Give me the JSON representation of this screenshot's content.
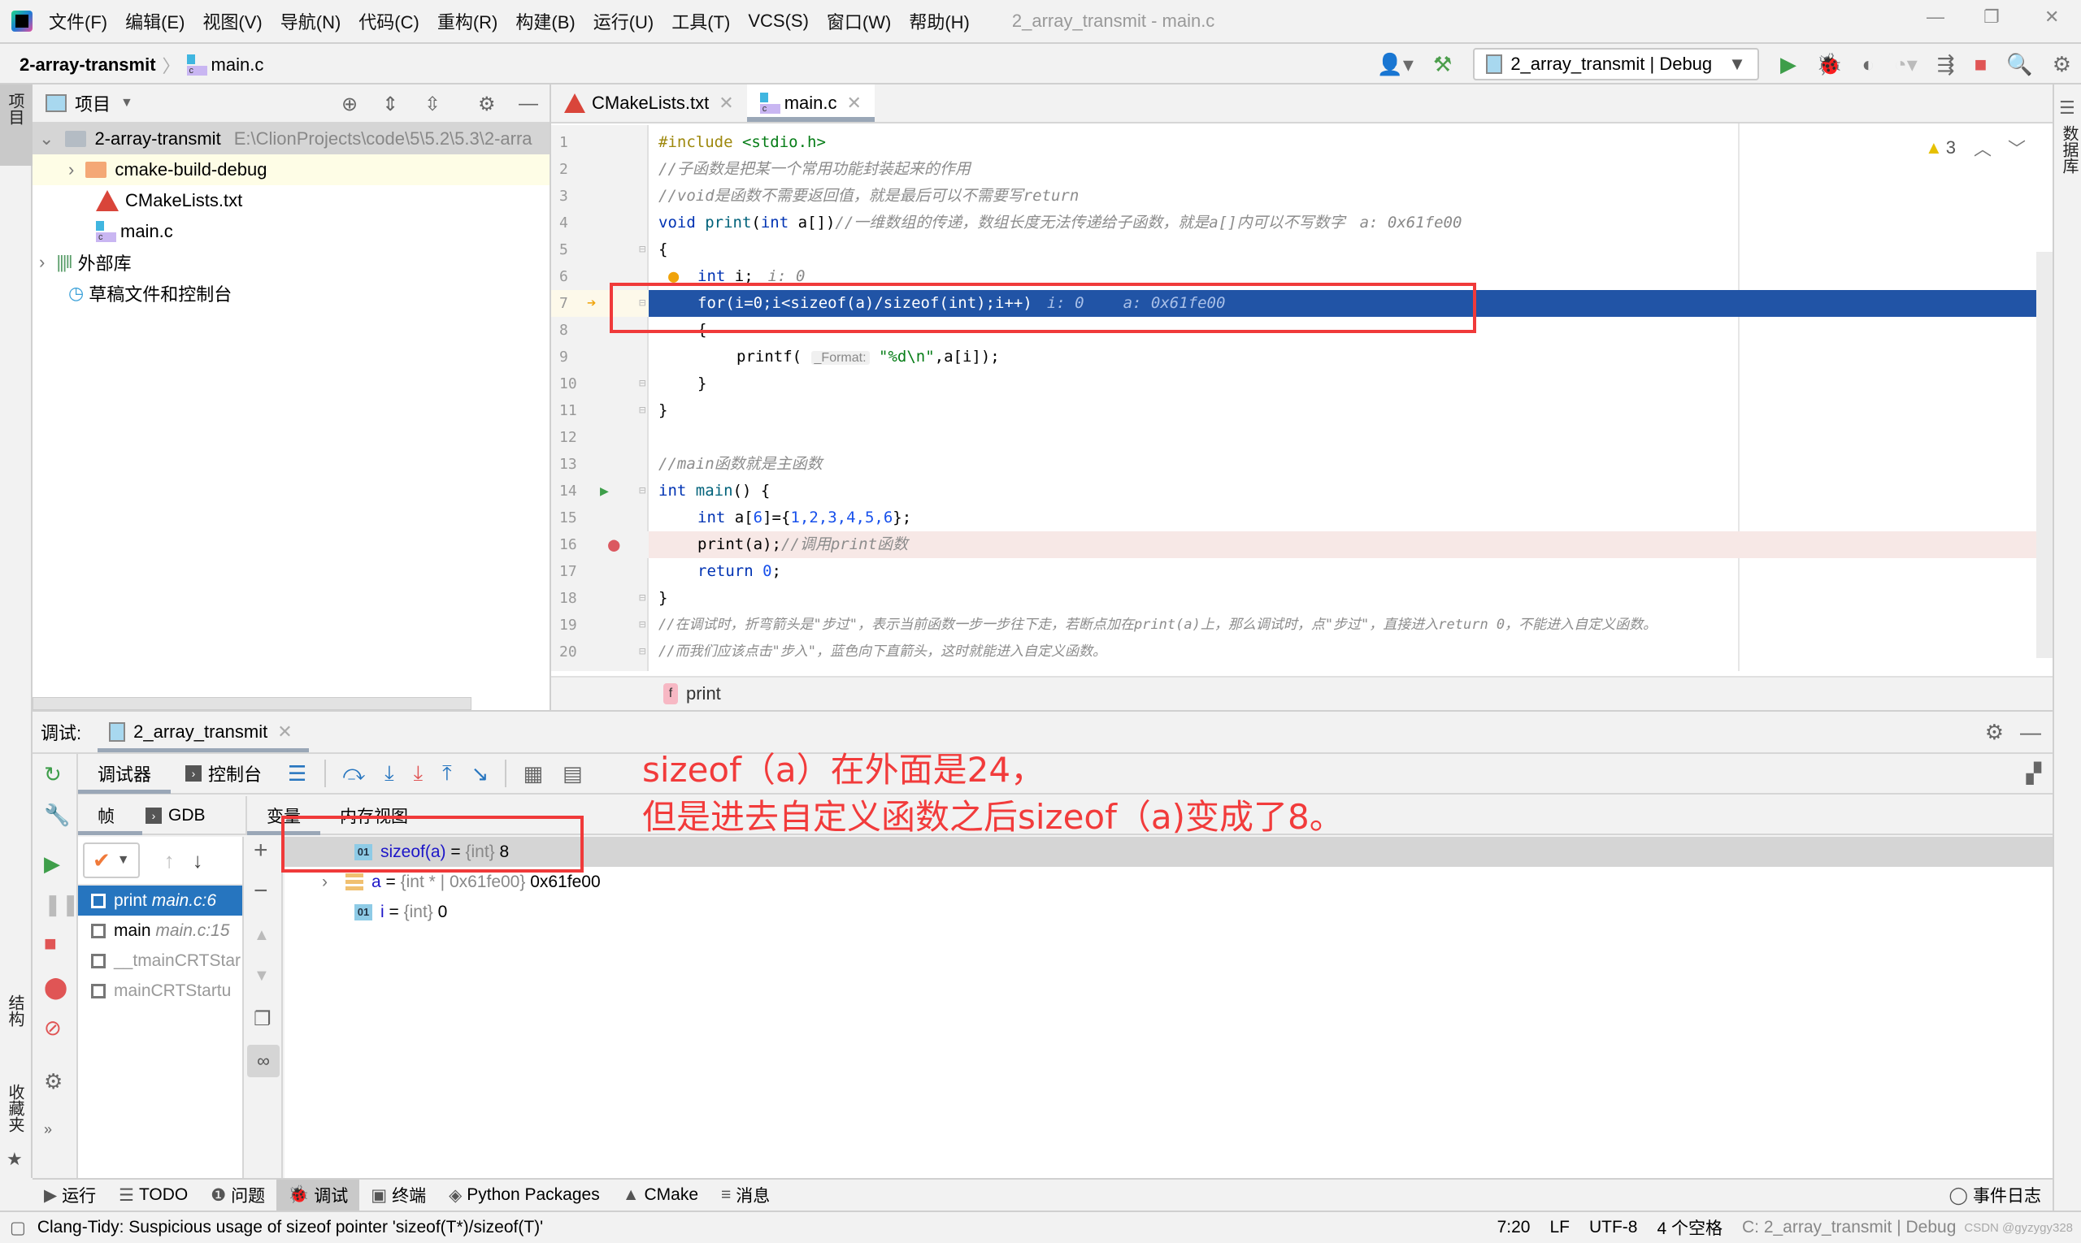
{
  "menubar": {
    "items": [
      "文件(F)",
      "编辑(E)",
      "视图(V)",
      "导航(N)",
      "代码(C)",
      "重构(R)",
      "构建(B)",
      "运行(U)",
      "工具(T)",
      "VCS(S)",
      "窗口(W)",
      "帮助(H)"
    ],
    "window_title": "2_array_transmit - main.c"
  },
  "navbar": {
    "project": "2-array-transmit",
    "file": "main.c",
    "run_config": "2_array_transmit | Debug"
  },
  "left_stripe": {
    "project_tab": "项目",
    "structure_tab": "结构",
    "favorites_tab": "收藏夹"
  },
  "right_stripe": {
    "database_tab": "数据库"
  },
  "project_panel": {
    "title": "项目",
    "root": {
      "name": "2-array-transmit",
      "path": "E:\\ClionProjects\\code\\5\\5.2\\5.3\\2-arra"
    },
    "children": [
      {
        "name": "cmake-build-debug",
        "type": "folder"
      },
      {
        "name": "CMakeLists.txt",
        "type": "cmake"
      },
      {
        "name": "main.c",
        "type": "c-file"
      }
    ],
    "external_libs": "外部库",
    "scratches": "草稿文件和控制台"
  },
  "editor": {
    "tabs": [
      {
        "label": "CMakeLists.txt",
        "active": false
      },
      {
        "label": "main.c",
        "active": true
      }
    ],
    "warnings_count": "3",
    "lines": [
      {
        "n": "1"
      },
      {
        "n": "2"
      },
      {
        "n": "3"
      },
      {
        "n": "4"
      },
      {
        "n": "5"
      },
      {
        "n": "6"
      },
      {
        "n": "7"
      },
      {
        "n": "8"
      },
      {
        "n": "9"
      },
      {
        "n": "10"
      },
      {
        "n": "11"
      },
      {
        "n": "12"
      },
      {
        "n": "13"
      },
      {
        "n": "14"
      },
      {
        "n": "15"
      },
      {
        "n": "16"
      },
      {
        "n": "17"
      },
      {
        "n": "18"
      },
      {
        "n": "19"
      },
      {
        "n": "20"
      }
    ],
    "code": {
      "l1_pp": "#include ",
      "l1_str": "<stdio.h>",
      "l2": "//子函数是把某一个常用功能封装起来的作用",
      "l3": "//void是函数不需要返回值，就是最后可以不需要写return",
      "l4_kw": "void ",
      "l4_fn": "print",
      "l4_a": "(",
      "l4_kw2": "int",
      "l4_b": " a[])",
      "l4_cm": "//一维数组的传递，数组长度无法传递给子函数，就是a[]内可以不写数字",
      "l4_inl": "a: 0x61fe00",
      "l5": "{",
      "l6_kw": "int",
      "l6_b": " i;",
      "l6_inl": "i: 0",
      "l7": "for(i=0;i<sizeof(a)/sizeof(int);i++)",
      "l7_inl1": "i: 0",
      "l7_inl2": "a: 0x61fe00",
      "l8": "{",
      "l9_a": "printf(",
      "l9_hint": "_Format:",
      "l9_str": "\"%d\\n\"",
      "l9_b": ",a[i]);",
      "l10": "}",
      "l11": "}",
      "l13": "//main函数就是主函数",
      "l14_kw": "int ",
      "l14_fn": "main",
      "l14_b": "() {",
      "l15_kw": "int",
      "l15_a": " a[",
      "l15_n": "6",
      "l15_b": "]={",
      "l15_vals": "1,2,3,4,5,6",
      "l15_c": "};",
      "l16_a": "print(a);",
      "l16_cm": "//调用print函数",
      "l17_kw": "return ",
      "l17_n": "0",
      "l17_b": ";",
      "l18": "}",
      "l19": "//在调试时，折弯箭头是\"步过\"，表示当前函数一步一步往下走，若断点加在print(a)上，那么调试时，点\"步过\"，直接进入return 0，不能进入自定义函数。",
      "l20": "//而我们应该点击\"步入\"，蓝色向下直箭头，这时就能进入自定义函数。"
    },
    "breadcrumb": "print"
  },
  "debug": {
    "label": "调试:",
    "session": "2_array_transmit",
    "tabs": {
      "debugger": "调试器",
      "console": "控制台"
    },
    "sub_tabs": {
      "frames": "帧",
      "gdb": "GDB",
      "variables": "变量",
      "memory": "内存视图"
    },
    "frames": [
      {
        "name": "print",
        "loc": "main.c:6",
        "selected": true
      },
      {
        "name": "main",
        "loc": "main.c:15",
        "selected": false
      },
      {
        "name": "__tmainCRTStar",
        "loc": "",
        "selected": false
      },
      {
        "name": "mainCRTStartu",
        "loc": "",
        "selected": false
      }
    ],
    "variables": [
      {
        "name": "sizeof(a)",
        "type": "{int}",
        "value": "8",
        "badge": "01"
      },
      {
        "name": "a",
        "type": "{int * | 0x61fe00}",
        "value": "0x61fe00",
        "badge": "arr"
      },
      {
        "name": "i",
        "type": "{int}",
        "value": "0",
        "badge": "01"
      }
    ]
  },
  "annotation": {
    "line1": "sizeof（a）在外面是24，",
    "line2": "但是进去自定义函数之后sizeof（a)变成了8。",
    "color": "#f23b3b"
  },
  "bottom_tools": [
    {
      "label": "运行",
      "icon": "▶"
    },
    {
      "label": "TODO",
      "icon": "☰"
    },
    {
      "label": "问题",
      "icon": "❶"
    },
    {
      "label": "调试",
      "icon": "🐞",
      "active": true
    },
    {
      "label": "终端",
      "icon": "▣"
    },
    {
      "label": "Python Packages",
      "icon": "◈"
    },
    {
      "label": "CMake",
      "icon": "▲"
    },
    {
      "label": "消息",
      "icon": "≡"
    }
  ],
  "event_log": "事件日志",
  "statusbar": {
    "message": "Clang-Tidy: Suspicious usage of sizeof pointer 'sizeof(T*)/sizeof(T)'",
    "position": "7:20",
    "line_sep": "LF",
    "encoding": "UTF-8",
    "indent": "4 个空格",
    "context": "C: 2_array_transmit | Debug",
    "watermark": "CSDN @gyzygy328"
  }
}
